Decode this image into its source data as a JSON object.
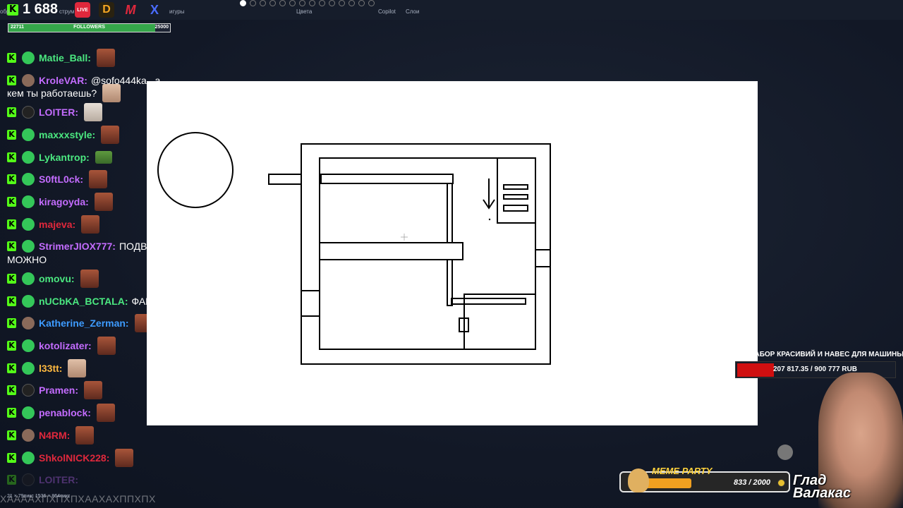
{
  "top": {
    "viewer_count": "1 688",
    "kick_letter": "K",
    "icons": [
      "LIVE",
      "D",
      "M",
      "X"
    ],
    "tiny_labels": {
      "left1": "обр",
      "left2": "струм",
      "figures": "игуры",
      "colors": "Цвета",
      "copilot": "Copilot",
      "layers": "Слои"
    }
  },
  "followers": {
    "label": "FOLLOWERS",
    "current": "22711",
    "goal": "25000",
    "progress": 0.908
  },
  "chat": {
    "messages": [
      {
        "user": "Matie_Ball:",
        "color": "#4be880",
        "badge": "green",
        "emote": "face",
        "text": ""
      },
      {
        "user": "KroleVAR:",
        "color": "#c46cff",
        "badge": "photo",
        "emote": "",
        "text": "@sofo444ka , а",
        "wrap": "кем ты работаешь?",
        "wrap_emote": "pale"
      },
      {
        "user": "LOITER:",
        "color": "#c46cff",
        "badge": "dark",
        "emote": "cat",
        "text": ""
      },
      {
        "user": "maxxxstyle:",
        "color": "#4be880",
        "badge": "green",
        "emote": "face",
        "text": ""
      },
      {
        "user": "Lykantrop:",
        "color": "#4be880",
        "badge": "green",
        "emote": "frog",
        "text": ""
      },
      {
        "user": "S0ftL0ck:",
        "color": "#c46cff",
        "badge": "green",
        "emote": "face",
        "text": ""
      },
      {
        "user": "kiragoyda:",
        "color": "#c46cff",
        "badge": "green",
        "emote": "face",
        "text": ""
      },
      {
        "user": "majeva:",
        "color": "#e0283c",
        "badge": "green",
        "emote": "face",
        "text": ""
      },
      {
        "user": "StrimerJIOX777:",
        "color": "#c46cff",
        "badge": "green",
        "emote": "",
        "text": "ПОДВАЛ",
        "wrap": "МОЖНО"
      },
      {
        "user": "omovu:",
        "color": "#4be880",
        "badge": "green",
        "emote": "face",
        "text": ""
      },
      {
        "user": "nUCbKA_BCTALA:",
        "color": "#4be880",
        "badge": "green",
        "emote": "",
        "text": "ФАКТ"
      },
      {
        "user": "Katherine_Zerman:",
        "color": "#3d9bff",
        "badge": "photo",
        "emote": "face",
        "text": ""
      },
      {
        "user": "kotolizater:",
        "color": "#c46cff",
        "badge": "green",
        "emote": "face",
        "text": ""
      },
      {
        "user": "l33tt:",
        "color": "#ffb940",
        "badge": "green",
        "emote": "pale",
        "text": ""
      },
      {
        "user": "Pramen:",
        "color": "#c46cff",
        "badge": "dark",
        "emote": "face",
        "text": ""
      },
      {
        "user": "penablock:",
        "color": "#c46cff",
        "badge": "green",
        "emote": "face",
        "text": ""
      },
      {
        "user": "N4RM:",
        "color": "#e0283c",
        "badge": "photo",
        "emote": "face",
        "text": ""
      },
      {
        "user": "ShkolNICK228:",
        "color": "#e0283c",
        "badge": "green",
        "emote": "face",
        "text": ""
      },
      {
        "user": "LOITER:",
        "color": "#c46cff",
        "badge": "dark",
        "emote": "",
        "text": "",
        "faded": true
      }
    ],
    "bottom_text": "ХААААХПХПХПХААХАХППХПХ"
  },
  "status_bar": "21 × 79пикс    1536 × 864пикс",
  "donation": {
    "title": "НА ЗАБОР КРАСИВИЙ И НАВЕС ДЛЯ МАШИНЫ",
    "amount": "207 817.35 / 900 777 RUB",
    "progress": 0.2307
  },
  "meme_party": {
    "title": "MEME PARTY",
    "count": "833 / 2000",
    "progress": 0.4165
  },
  "streamer": {
    "name_line1": "Глад",
    "name_line2": "Валакас"
  },
  "colors": {
    "kick_green": "#53fc18",
    "donation_red": "#d00f10",
    "meme_yellow": "#ffd23c"
  }
}
